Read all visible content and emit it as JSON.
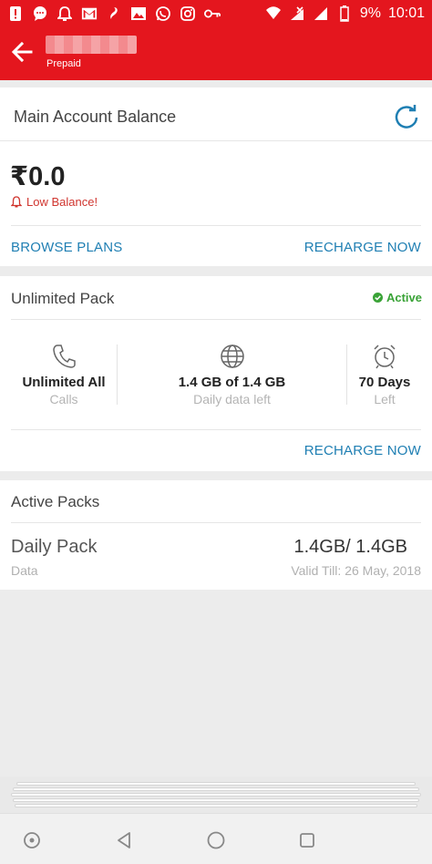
{
  "status_bar": {
    "battery_text": "9%",
    "time": "10:01",
    "left_icons": [
      "alert-icon",
      "message-icon",
      "notification-bell-icon",
      "gmail-icon",
      "airtel-icon",
      "gallery-icon",
      "whatsapp-icon",
      "instagram-icon",
      "vpn-key-icon"
    ],
    "right_icons": [
      "wifi-icon",
      "signal-icon",
      "battery-icon"
    ]
  },
  "app_bar": {
    "subtitle": "Prepaid",
    "back_icon": "arrow-left-icon"
  },
  "main_balance": {
    "title": "Main Account Balance",
    "amount": "₹0.0",
    "warning": "Low Balance!",
    "browse_label": "BROWSE PLANS",
    "recharge_label": "RECHARGE NOW"
  },
  "unlimited_pack": {
    "title": "Unlimited Pack",
    "status": "Active",
    "columns": [
      {
        "value": "Unlimited All",
        "label": "Calls",
        "icon": "phone-icon"
      },
      {
        "value": "1.4 GB of 1.4 GB",
        "label": "Daily data left",
        "icon": "globe-icon"
      },
      {
        "value": "70 Days",
        "label": "Left",
        "icon": "alarm-clock-icon"
      }
    ],
    "recharge_label": "RECHARGE NOW"
  },
  "active_packs": {
    "title": "Active Packs",
    "items": [
      {
        "name": "Daily Pack",
        "type": "Data",
        "value": "1.4GB/ 1.4GB",
        "validity": "Valid Till: 26 May, 2018"
      }
    ]
  },
  "colors": {
    "brand_red": "#e4161e",
    "link_blue": "#1f7fb3",
    "active_green": "#3aa337",
    "warning_red": "#d0352f"
  }
}
